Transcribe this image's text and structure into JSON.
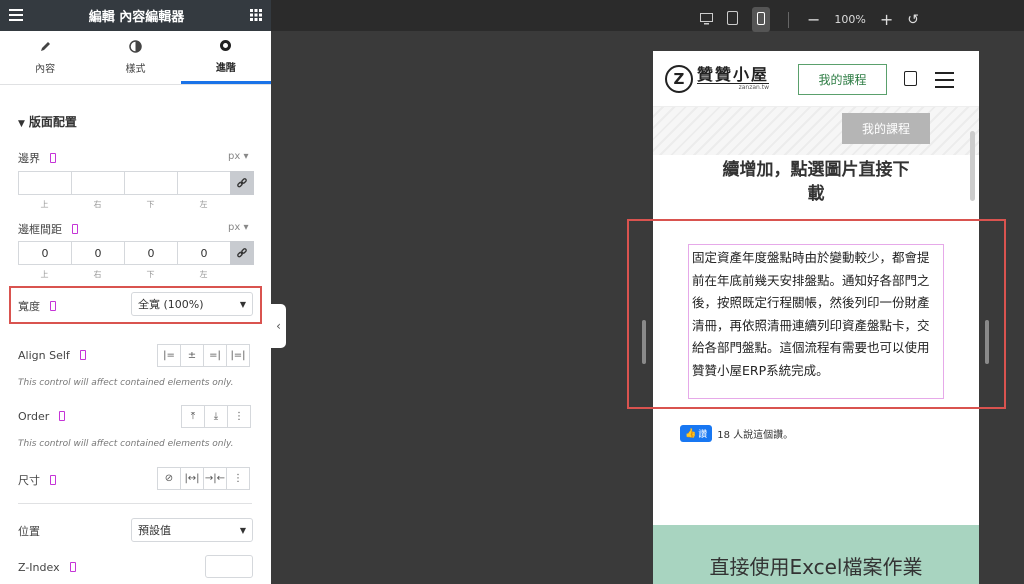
{
  "header": {
    "title": "編輯 內容編輯器"
  },
  "tabs": [
    {
      "label": "內容",
      "icon": "pencil-icon"
    },
    {
      "label": "樣式",
      "icon": "half-circle-icon"
    },
    {
      "label": "進階",
      "icon": "gear-icon"
    }
  ],
  "section": {
    "title": "版面配置"
  },
  "margin": {
    "label": "邊界",
    "unit": "px",
    "values": [
      "",
      "",
      "",
      ""
    ],
    "sides": [
      "上",
      "右",
      "下",
      "左"
    ]
  },
  "padding": {
    "label": "邊框間距",
    "unit": "px",
    "values": [
      "0",
      "0",
      "0",
      "0"
    ],
    "sides": [
      "上",
      "右",
      "下",
      "左"
    ]
  },
  "width": {
    "label": "寬度",
    "value": "全寬 (100%)"
  },
  "align_self": {
    "label": "Align Self",
    "note": "This control will affect contained elements only."
  },
  "order": {
    "label": "Order",
    "note": "This control will affect contained elements only."
  },
  "size": {
    "label": "尺寸"
  },
  "position": {
    "label": "位置",
    "value": "預設值"
  },
  "zindex": {
    "label": "Z-Index"
  },
  "zoom": {
    "value": "100%"
  },
  "site": {
    "logo_text": "贊贊小屋",
    "logo_sub": "zanzan.tw",
    "course_button": "我的課程",
    "heading_lines": [
      "續增加，點選圖片直接下",
      "載"
    ],
    "paragraph": "固定資產年度盤點時由於變動較少，都會提前在年底前幾天安排盤點。通知好各部門之後，按照既定行程關帳，然後列印一份財產清冊，再依照清冊連續列印資產盤點卡，交給各部門盤點。這個流程有需要也可以使用贊贊小屋ERP系統完成。",
    "like_button": "讚",
    "like_text": "18 人說這個讚。",
    "bottom_text": "直接使用Excel檔案作業"
  },
  "colors": {
    "panel_header": "#343a40",
    "highlight": "#d9534f",
    "responsive": "#c534d7",
    "tab_active": "#1a73e8",
    "bottom_band": "#a8d4c0"
  }
}
